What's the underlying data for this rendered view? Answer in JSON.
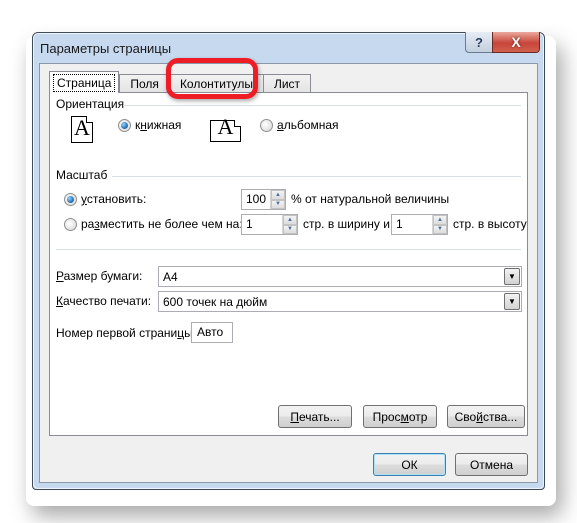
{
  "window": {
    "title": "Параметры страницы",
    "help_label": "?",
    "close_label": "X"
  },
  "tabs": [
    {
      "label": "Страница",
      "active": true
    },
    {
      "label": "Поля",
      "active": false
    },
    {
      "label": "Колонтитулы",
      "active": false,
      "highlighted": true
    },
    {
      "label": "Лист",
      "active": false
    }
  ],
  "orientation": {
    "group_label": "Ориентация",
    "portrait": {
      "pre": "к",
      "mnemonic": "н",
      "post": "ижная",
      "checked": true,
      "icon_glyph": "A"
    },
    "landscape": {
      "pre": "",
      "mnemonic": "а",
      "post": "льбомная",
      "checked": false,
      "icon_glyph": "A"
    }
  },
  "scale": {
    "group_label": "Масштаб",
    "set": {
      "pre": "",
      "mnemonic": "у",
      "post": "становить:",
      "checked": true,
      "value": "100",
      "suffix": "% от натуральной величины"
    },
    "fit": {
      "pre": "ра",
      "mnemonic": "з",
      "post": "местить не более чем на:",
      "checked": false,
      "wide_value": "1",
      "wide_suffix": "стр. в ширину и",
      "tall_value": "1",
      "tall_suffix": "стр. в высоту"
    }
  },
  "paper_size": {
    "pre": "",
    "mnemonic": "Р",
    "post": "азмер бумаги:",
    "value": "A4"
  },
  "print_quality": {
    "pre": "",
    "mnemonic": "К",
    "post": "ачество печати:",
    "value": "600 точек на дюйм"
  },
  "first_page": {
    "pre": "Номер первой страни",
    "mnemonic": "ц",
    "post": "ы:",
    "value": "Авто"
  },
  "buttons": {
    "print": {
      "pre": "",
      "mnemonic": "П",
      "post": "ечать..."
    },
    "preview": {
      "pre": "Прос",
      "mnemonic": "м",
      "post": "отр"
    },
    "properties": {
      "pre": "Сво",
      "mnemonic": "й",
      "post": "ства..."
    },
    "ok": "ОК",
    "cancel": "Отмена"
  },
  "colors": {
    "highlight_ring": "#ee1c25",
    "radio_checked": "#1d64a8",
    "close_button": "#c8453a"
  }
}
